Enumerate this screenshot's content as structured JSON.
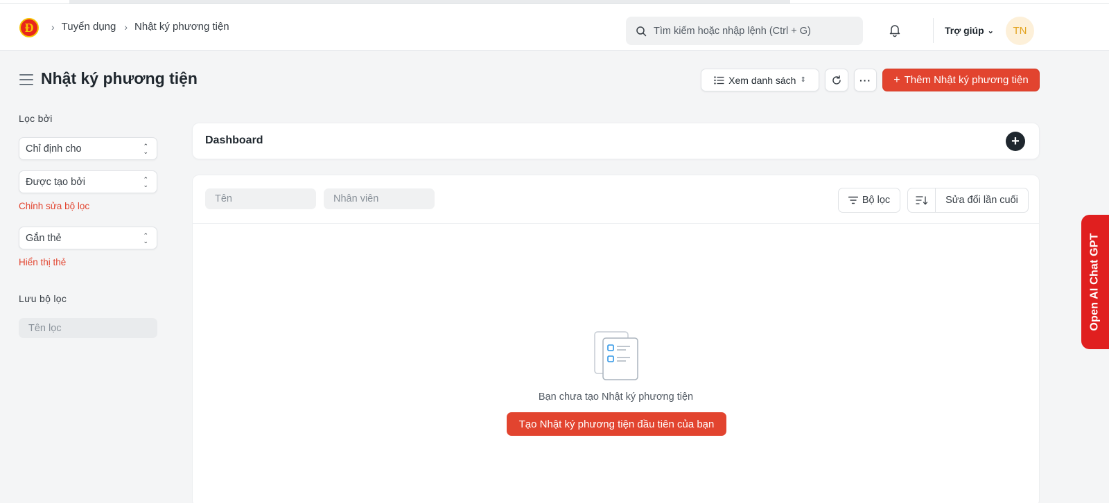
{
  "navbar": {
    "logo_letter": "Đ",
    "breadcrumbs": [
      "Tuyển dụng",
      "Nhật ký phương tiện"
    ],
    "search_placeholder": "Tìm kiếm hoặc nhập lệnh (Ctrl + G)",
    "help_label": "Trợ giúp",
    "avatar_initials": "TN"
  },
  "page": {
    "title": "Nhật ký phương tiện",
    "view_label": "Xem danh sách",
    "more_label": "···",
    "add_label": "Thêm Nhật ký phương tiện"
  },
  "sidebar": {
    "filter_by_label": "Lọc bởi",
    "assigned_to": "Chỉ định cho",
    "created_by": "Được tạo bởi",
    "edit_filters": "Chỉnh sửa bộ lọc",
    "tags": "Gắn thẻ",
    "show_tags": "Hiển thị thẻ",
    "save_filter_label": "Lưu bộ lọc",
    "filter_name_placeholder": "Tên lọc"
  },
  "dashboard": {
    "title": "Dashboard"
  },
  "list": {
    "name_placeholder": "Tên",
    "employee_placeholder": "Nhân viên",
    "filter_label": "Bộ lọc",
    "sort_label": "Sửa đổi lần cuối",
    "empty_message": "Bạn chưa tạo Nhật ký phương tiện",
    "create_first_label": "Tạo Nhật ký phương tiện đầu tiên của bạn"
  },
  "side_tab": {
    "label": "Open AI Chat GPT"
  },
  "colors": {
    "primary": "#e2442f",
    "gpt_tab": "#e01f1f",
    "avatar_bg": "#fdf0d9",
    "avatar_text": "#e3a31f"
  }
}
